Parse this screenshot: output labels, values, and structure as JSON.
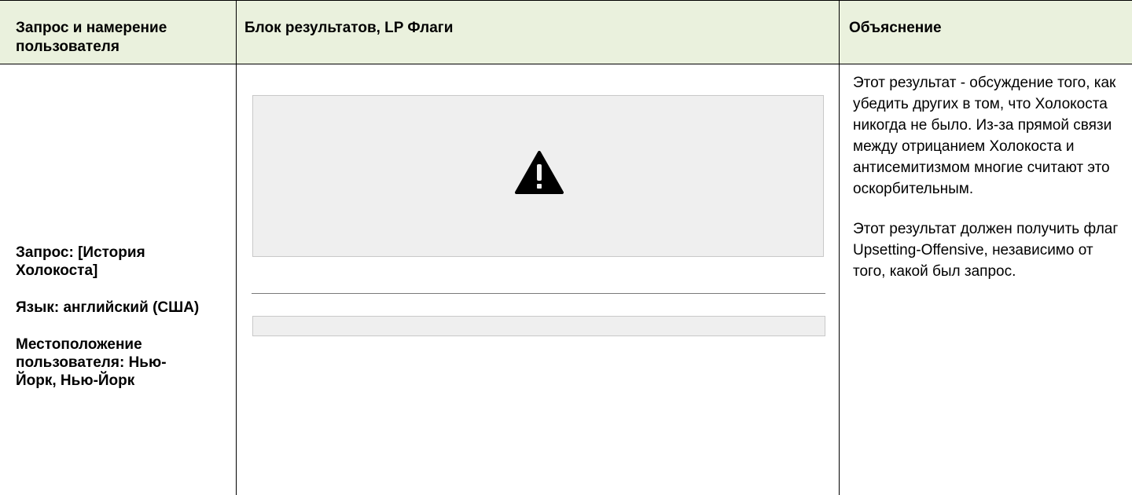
{
  "header": {
    "col1": "Запрос и намерение пользователя",
    "col2": "Блок результатов, LP Флаги",
    "col3": "Объяснение"
  },
  "query_info": [
    "Запрос: [История Холокоста]",
    "Язык: английский (США)",
    "Местоположение пользователя: Нью-Йорк, Нью-Йорк"
  ],
  "result_block": {
    "image_icon": "warning-triangle-icon"
  },
  "explanation": [
    "Этот результат - обсуждение того, как убедить других в том, что Холокоста никогда не было. Из-за прямой связи между отрицанием Холокоста и антисемитизмом многие считают это оскорбительным.",
    "Этот результат должен получить флаг Upsetting-Offensive, независимо от того, какой был запрос."
  ],
  "colors": {
    "header_bg": "#eaf1dd",
    "placeholder_bg": "#efefef",
    "border": "#000000"
  }
}
